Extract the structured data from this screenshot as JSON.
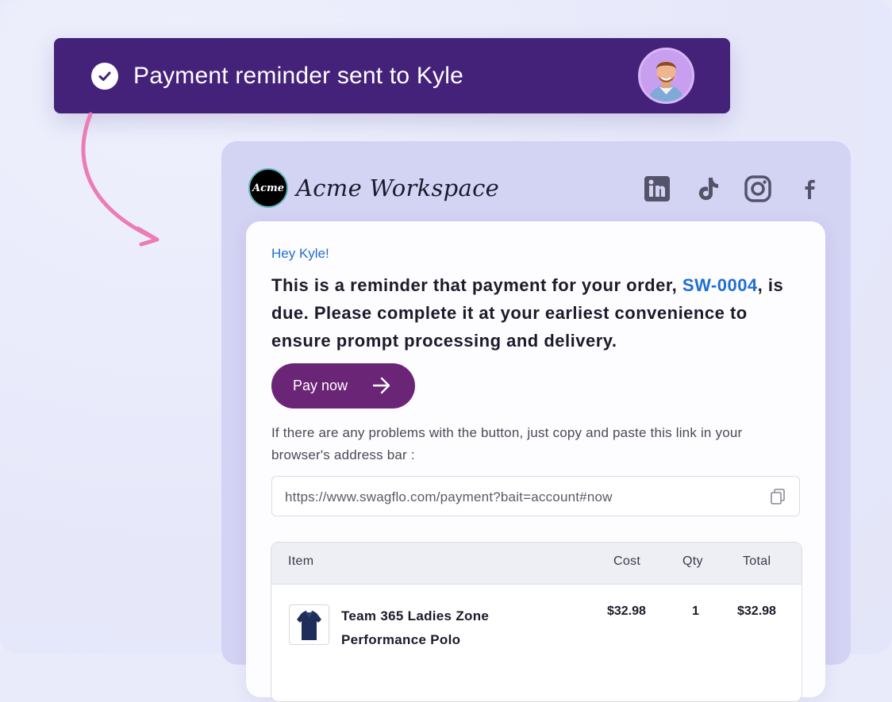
{
  "notification": {
    "text": "Payment reminder sent to Kyle",
    "icon": "check-circle-icon",
    "avatar": "kyle-avatar"
  },
  "colors": {
    "notification_bg": "#45227a",
    "panel_bg": "#d3d3f4",
    "accent_blue": "#1f6fd1",
    "button_bg": "#6b2576",
    "arrow_pink": "#ec7cb6"
  },
  "brand": {
    "logo_text": "Acme",
    "name": "Acme Workspace"
  },
  "social": [
    "linkedin-icon",
    "tiktok-icon",
    "instagram-icon",
    "facebook-icon"
  ],
  "email": {
    "greeting": "Hey Kyle!",
    "message_before": "This is a reminder that payment for your order,",
    "order_id": "SW-0004",
    "message_after": ", is due. Please complete it at your earliest convenience to ensure prompt processing and delivery.",
    "pay_button": "Pay now",
    "help_text": "If there are any problems with the button, just copy and paste this link in your browser's address bar :",
    "payment_link": "https://www.swagflo.com/payment?bait=account#now"
  },
  "table": {
    "headers": {
      "item": "Item",
      "cost": "Cost",
      "qty": "Qty",
      "total": "Total"
    },
    "rows": [
      {
        "name": "Team 365 Ladies Zone Performance Polo",
        "cost": "$32.98",
        "qty": "1",
        "total": "$32.98"
      }
    ]
  }
}
